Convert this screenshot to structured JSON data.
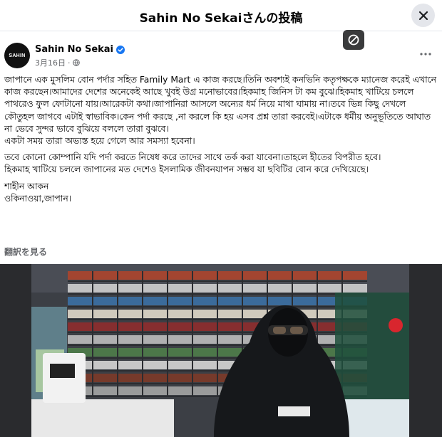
{
  "dialog": {
    "title": "Sahin No Sekaiさんの投稿",
    "close_icon": "close-icon"
  },
  "post": {
    "author": "Sahin No Sekai",
    "verified": true,
    "date": "3月16日",
    "audience_icon": "globe-icon",
    "avatar_text": "SAHIN",
    "paragraphs": [
      "জাপানে এক মুসলিম বোন পর্দার সহিত Family  Mart এ কাজ করছে।তিনি অবশ্যই কনভিনি কতৃপক্ষকে ম্যানেজ করেই এখানে কাজ করছেন।আমাদের দেশের অনেকেই আছে খুবই উগ্র মনোভাবের।হিকমাহ জিনিস টা কম বুঝে।হিকমাহ খাটিয়ে চললে পাথরেও ফুল ফোটানো যায়।আরেকটা কথা।জাপানিরা আসলে অন্যের ধর্ম নিয়ে মাথা ঘামায় না।তবে ভিন্ন কিছু দেখলে কৌতুহল জাগবে এটাই স্বাভাবিক।কেন পর্দা করছে ,না করলে কি হয় এসব প্রশ্ন তারা করবেই।এটাকে ধর্মীয় অনুভূতিতে আঘাত না ভেবে সুন্দর ভাবে বুঝিয়ে বললে তারা বুঝবে।",
      "একটা সময় তারা অভ্যস্ত হয়ে গেলে আর সমস্যা হবেনা।",
      "তবে কোনো কোম্পানি যদি পর্দা করতে নিষেধ করে তাদের সাথে তর্ক করা যাবেনা।তাহলে হীতের বিপরীত হবে।",
      "হিকমাহ খাটিয়ে চললে জাপানের মত দেশেও ইসলামিক জীবনযাপন সম্ভব যা ছবিটির বোন করে দেখিয়েছে।",
      "শাহীন আকন",
      "ওকিনাওয়া,জাপান।"
    ],
    "translate_label": "翻訳を見る"
  }
}
